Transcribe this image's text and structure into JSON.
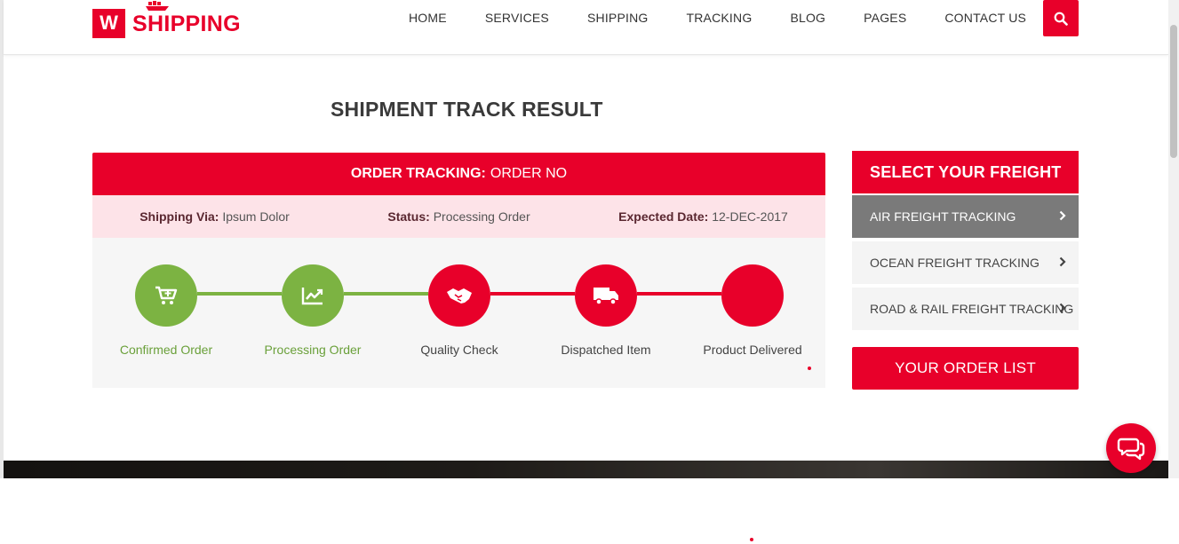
{
  "brand": {
    "logo_letter": "W",
    "name": "SHIPPING"
  },
  "nav": {
    "items": [
      "HOME",
      "SERVICES",
      "SHIPPING",
      "TRACKING",
      "BLOG",
      "PAGES",
      "CONTACT US"
    ]
  },
  "page_title": "SHIPMENT TRACK RESULT",
  "tracking": {
    "heading_bold": "ORDER TRACKING:",
    "heading_value": "ORDER NO",
    "shipping_via_label": "Shipping Via:",
    "shipping_via_value": "Ipsum Dolor",
    "status_label": "Status:",
    "status_value": "Processing Order",
    "expected_label": "Expected Date:",
    "expected_value": "12-DEC-2017",
    "steps": [
      {
        "label": "Confirmed Order",
        "state": "complete",
        "icon": "cart-plus-icon"
      },
      {
        "label": "Processing Order",
        "state": "complete",
        "icon": "chart-icon"
      },
      {
        "label": "Quality Check",
        "state": "pending",
        "icon": "handshake-icon"
      },
      {
        "label": "Dispatched Item",
        "state": "pending",
        "icon": "truck-icon"
      },
      {
        "label": "Product Delivered",
        "state": "pending",
        "icon": ""
      }
    ]
  },
  "sidebar": {
    "heading": "SELECT YOUR FREIGHT",
    "items": [
      {
        "label": "AIR FREIGHT TRACKING",
        "active": true
      },
      {
        "label": "OCEAN FREIGHT TRACKING",
        "active": false
      },
      {
        "label": "ROAD & RAIL FREIGHT TRACKING",
        "active": false
      }
    ],
    "order_button": "YOUR ORDER LIST"
  },
  "colors": {
    "accent": "#e8002a",
    "complete": "#7cb342",
    "info_bg": "#fde3e8",
    "active_item": "#7a7a7a"
  }
}
